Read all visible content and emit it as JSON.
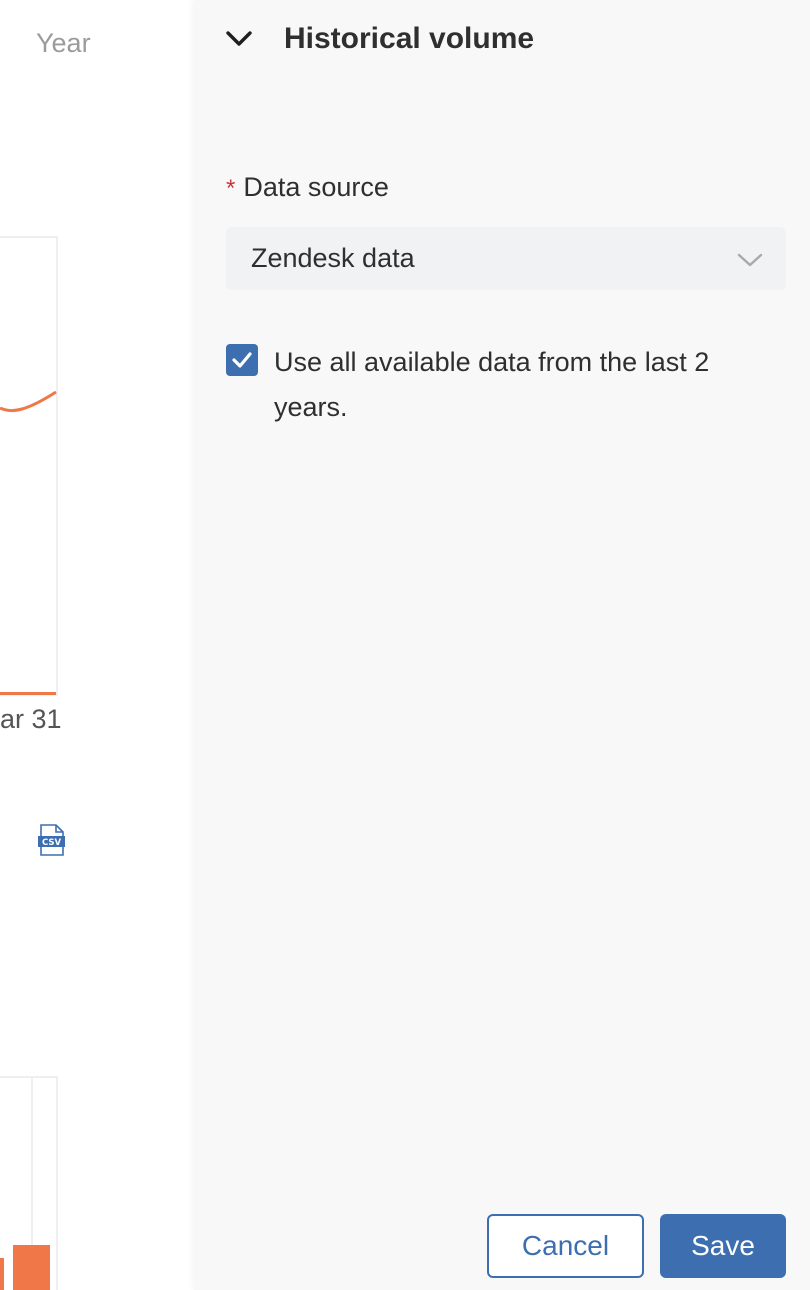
{
  "background_view": {
    "period_label": "Year",
    "chart_line": {
      "x_tick_label": "ar 31",
      "series_color": "#f07848"
    },
    "export_icon": "csv-file-icon",
    "chart_bars": {
      "series_color": "#f07848"
    }
  },
  "side_panel": {
    "section": {
      "title": "Historical volume",
      "expanded": true,
      "toggle_icon": "chevron-down-icon"
    },
    "data_source": {
      "required_mark": "*",
      "label": "Data source",
      "selected_value": "Zendesk data",
      "dropdown_icon": "chevron-down-icon"
    },
    "use_all_data": {
      "checked": true,
      "label": "Use all available data from the last 2 years."
    },
    "actions": {
      "cancel_label": "Cancel",
      "save_label": "Save"
    }
  },
  "colors": {
    "accent": "#3d6fb0",
    "required": "#cc3340",
    "chart_series": "#f07848",
    "panel_background": "#f8f8f8",
    "select_background": "#f1f2f4"
  }
}
